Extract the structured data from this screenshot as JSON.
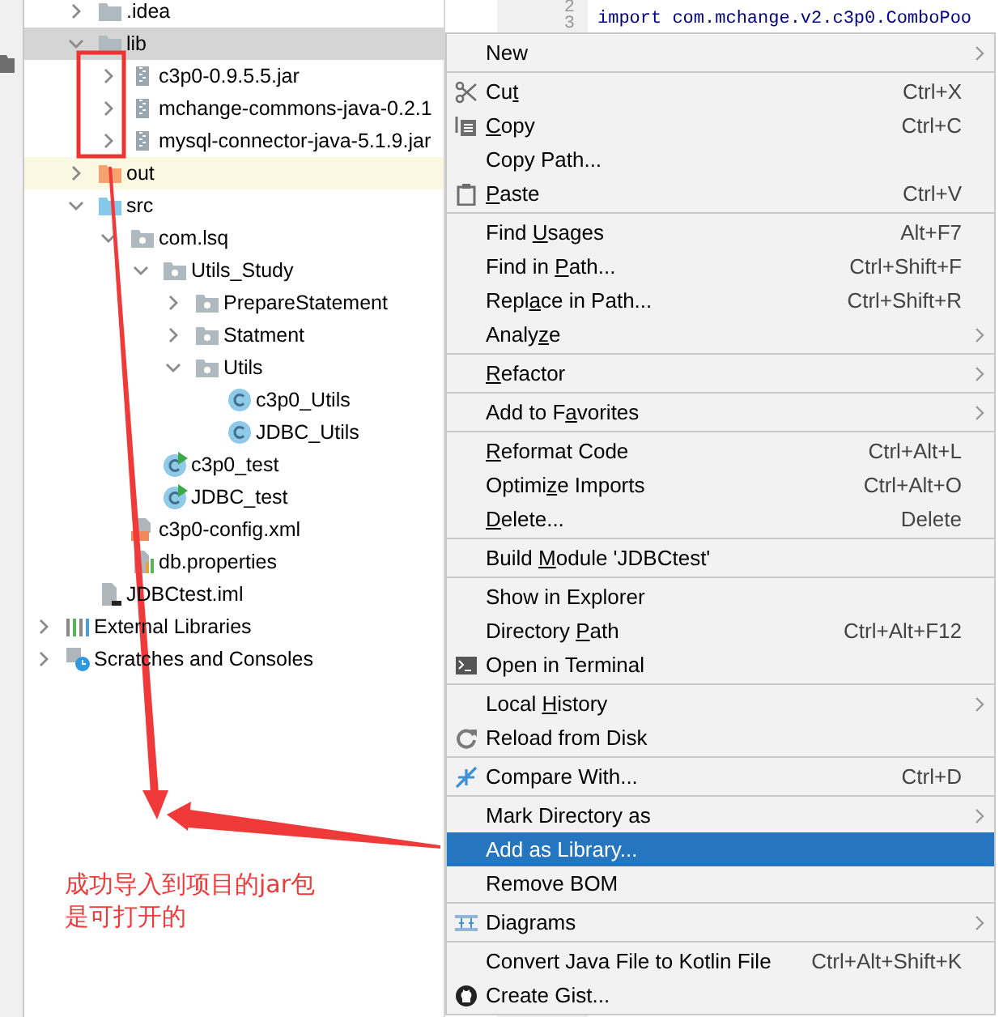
{
  "editor": {
    "line_numbers": [
      "2",
      "3"
    ],
    "code_line": "import com.mchange.v2.c3p0.ComboPoo"
  },
  "tree": [
    {
      "children": [
        {
          "label": ".idea",
          "kind": "folder",
          "expanded": false,
          "selected": false
        },
        {
          "label": "lib",
          "kind": "folder",
          "expanded": true,
          "selected": true,
          "children": [
            {
              "label": "c3p0-0.9.5.5.jar",
              "kind": "jar",
              "expanded": false,
              "selected": false
            },
            {
              "label": "mchange-commons-java-0.2.1",
              "kind": "jar",
              "expanded": false,
              "selected": false
            },
            {
              "label": "mysql-connector-java-5.1.9.jar",
              "kind": "jar",
              "expanded": false,
              "selected": false
            }
          ]
        },
        {
          "label": "out",
          "kind": "excluded-folder",
          "expanded": false,
          "selected": false
        },
        {
          "label": "src",
          "kind": "source-folder",
          "expanded": true,
          "selected": false,
          "children": [
            {
              "label": "com.lsq",
              "kind": "package",
              "expanded": true,
              "selected": false,
              "children": [
                {
                  "label": "Utils_Study",
                  "kind": "package",
                  "expanded": true,
                  "selected": false,
                  "children": [
                    {
                      "label": "PrepareStatement",
                      "kind": "package",
                      "expanded": false,
                      "selected": false
                    },
                    {
                      "label": "Statment",
                      "kind": "package",
                      "expanded": false,
                      "selected": false
                    },
                    {
                      "label": "Utils",
                      "kind": "package",
                      "expanded": true,
                      "selected": false,
                      "children": [
                        {
                          "label": "c3p0_Utils",
                          "kind": "class",
                          "selected": false
                        },
                        {
                          "label": "JDBC_Utils",
                          "kind": "class",
                          "selected": false
                        }
                      ]
                    }
                  ]
                },
                {
                  "label": "c3p0_test",
                  "kind": "runnable-class",
                  "selected": false
                },
                {
                  "label": "JDBC_test",
                  "kind": "runnable-class",
                  "selected": false
                }
              ]
            },
            {
              "label": "c3p0-config.xml",
              "kind": "xml",
              "selected": false
            },
            {
              "label": "db.properties",
              "kind": "properties",
              "selected": false
            }
          ]
        },
        {
          "label": "JDBCtest.iml",
          "kind": "iml",
          "selected": false
        }
      ]
    },
    {
      "label": "External Libraries",
      "kind": "libraries",
      "expanded": false,
      "selected": false
    },
    {
      "label": "Scratches and Consoles",
      "kind": "scratches",
      "expanded": false,
      "selected": false
    }
  ],
  "context_menu": {
    "groups": [
      [
        {
          "label": [
            {
              "text": "New",
              "underlined": false
            }
          ],
          "submenu": true,
          "selected": false
        }
      ],
      [
        {
          "label": [
            {
              "text": "Cu",
              "underlined": false
            },
            {
              "text": "t",
              "underlined": true
            }
          ],
          "shortcut": "Ctrl+X",
          "kind": "scissors",
          "submenu": false,
          "selected": false
        },
        {
          "label": [
            {
              "text": "C",
              "underlined": true
            },
            {
              "text": "opy",
              "underlined": false
            }
          ],
          "shortcut": "Ctrl+C",
          "kind": "copy",
          "submenu": false,
          "selected": false
        },
        {
          "label": [
            {
              "text": "Copy Path...",
              "underlined": false
            }
          ],
          "submenu": false,
          "selected": false
        },
        {
          "label": [
            {
              "text": "P",
              "underlined": true
            },
            {
              "text": "aste",
              "underlined": false
            }
          ],
          "shortcut": "Ctrl+V",
          "kind": "paste",
          "submenu": false,
          "selected": false
        }
      ],
      [
        {
          "label": [
            {
              "text": "Find ",
              "underlined": false
            },
            {
              "text": "U",
              "underlined": true
            },
            {
              "text": "sages",
              "underlined": false
            }
          ],
          "shortcut": "Alt+F7",
          "submenu": false,
          "selected": false
        },
        {
          "label": [
            {
              "text": "Find in ",
              "underlined": false
            },
            {
              "text": "P",
              "underlined": true
            },
            {
              "text": "ath...",
              "underlined": false
            }
          ],
          "shortcut": "Ctrl+Shift+F",
          "submenu": false,
          "selected": false
        },
        {
          "label": [
            {
              "text": "Repl",
              "underlined": false
            },
            {
              "text": "a",
              "underlined": true
            },
            {
              "text": "ce in Path...",
              "underlined": false
            }
          ],
          "shortcut": "Ctrl+Shift+R",
          "submenu": false,
          "selected": false
        },
        {
          "label": [
            {
              "text": "Analy",
              "underlined": false
            },
            {
              "text": "z",
              "underlined": true
            },
            {
              "text": "e",
              "underlined": false
            }
          ],
          "submenu": true,
          "selected": false
        }
      ],
      [
        {
          "label": [
            {
              "text": "R",
              "underlined": true
            },
            {
              "text": "efactor",
              "underlined": false
            }
          ],
          "submenu": true,
          "selected": false
        }
      ],
      [
        {
          "label": [
            {
              "text": "Add to F",
              "underlined": false
            },
            {
              "text": "a",
              "underlined": true
            },
            {
              "text": "vorites",
              "underlined": false
            }
          ],
          "submenu": true,
          "selected": false
        }
      ],
      [
        {
          "label": [
            {
              "text": "R",
              "underlined": true
            },
            {
              "text": "eformat Code",
              "underlined": false
            }
          ],
          "shortcut": "Ctrl+Alt+L",
          "submenu": false,
          "selected": false
        },
        {
          "label": [
            {
              "text": "Optimi",
              "underlined": false
            },
            {
              "text": "z",
              "underlined": true
            },
            {
              "text": "e Imports",
              "underlined": false
            }
          ],
          "shortcut": "Ctrl+Alt+O",
          "submenu": false,
          "selected": false
        },
        {
          "label": [
            {
              "text": "D",
              "underlined": true
            },
            {
              "text": "elete...",
              "underlined": false
            }
          ],
          "shortcut": "Delete",
          "submenu": false,
          "selected": false
        }
      ],
      [
        {
          "label": [
            {
              "text": "Build ",
              "underlined": false
            },
            {
              "text": "M",
              "underlined": true
            },
            {
              "text": "odule 'JDBCtest'",
              "underlined": false
            }
          ],
          "submenu": false,
          "selected": false
        }
      ],
      [
        {
          "label": [
            {
              "text": "Show in Explorer",
              "underlined": false
            }
          ],
          "submenu": false,
          "selected": false
        },
        {
          "label": [
            {
              "text": "Directory ",
              "underlined": false
            },
            {
              "text": "P",
              "underlined": true
            },
            {
              "text": "ath",
              "underlined": false
            }
          ],
          "shortcut": "Ctrl+Alt+F12",
          "submenu": false,
          "selected": false
        },
        {
          "label": [
            {
              "text": "Open in Terminal",
              "underlined": false
            }
          ],
          "kind": "terminal",
          "submenu": false,
          "selected": false
        }
      ],
      [
        {
          "label": [
            {
              "text": "Local ",
              "underlined": false
            },
            {
              "text": "H",
              "underlined": true
            },
            {
              "text": "istory",
              "underlined": false
            }
          ],
          "submenu": true,
          "selected": false
        },
        {
          "label": [
            {
              "text": "Reload from Disk",
              "underlined": false
            }
          ],
          "kind": "reload",
          "submenu": false,
          "selected": false
        }
      ],
      [
        {
          "label": [
            {
              "text": "Compare With...",
              "underlined": false
            }
          ],
          "shortcut": "Ctrl+D",
          "kind": "compare",
          "submenu": false,
          "selected": false
        }
      ],
      [
        {
          "label": [
            {
              "text": "Mark Directory as",
              "underlined": false
            }
          ],
          "submenu": true,
          "selected": false
        },
        {
          "label": [
            {
              "text": "Add as Library...",
              "underlined": false
            }
          ],
          "submenu": false,
          "selected": true
        },
        {
          "label": [
            {
              "text": "Remove BOM",
              "underlined": false
            }
          ],
          "submenu": false,
          "selected": false
        }
      ],
      [
        {
          "label": [
            {
              "text": "Diagrams",
              "underlined": false
            }
          ],
          "kind": "diagrams",
          "submenu": true,
          "selected": false
        }
      ],
      [
        {
          "label": [
            {
              "text": "Convert Java File to Kotlin File",
              "underlined": false
            }
          ],
          "shortcut": "Ctrl+Alt+Shift+K",
          "submenu": false,
          "selected": false
        },
        {
          "label": [
            {
              "text": "Create Gist...",
              "underlined": false
            }
          ],
          "kind": "github",
          "submenu": false,
          "selected": false
        }
      ]
    ]
  },
  "annotation": {
    "note_lines": [
      "成功导入到项目的jar包",
      "是可打开的"
    ]
  }
}
